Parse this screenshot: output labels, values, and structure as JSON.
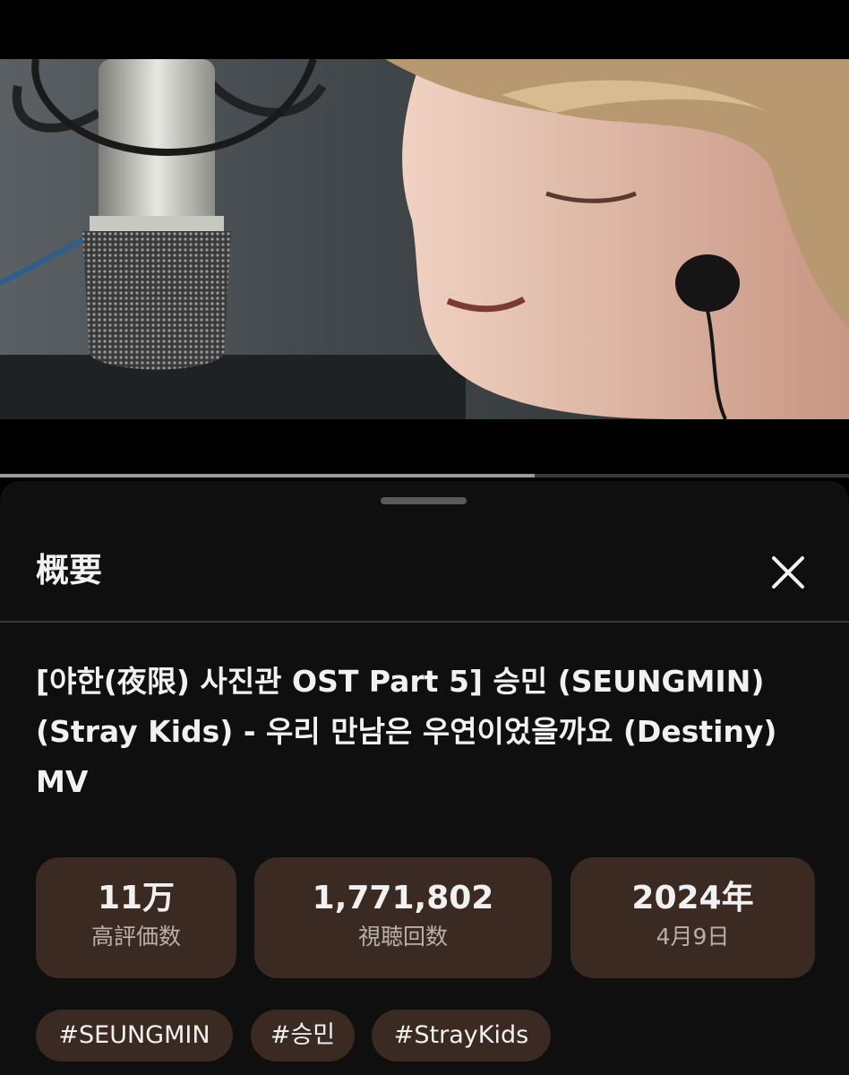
{
  "player": {
    "progress_fraction": 0.63
  },
  "sheet": {
    "title": "概要",
    "close_icon": "close-icon",
    "video_title": "[야한(夜限) 사진관 OST Part 5] 승민 (SEUNGMIN) (Stray Kids) - 우리 만남은 우연이었을까요 (Destiny) MV"
  },
  "stats": [
    {
      "value": "11万",
      "label": "高評価数"
    },
    {
      "value": "1,771,802",
      "label": "視聴回数"
    },
    {
      "value": "2024年",
      "label": "4月9日"
    }
  ],
  "tags": [
    "#SEUNGMIN",
    "#승민",
    "#StrayKids"
  ],
  "colors": {
    "sheet_bg": "#0f0f0f",
    "chip_bg": "#3a2a22",
    "text_primary": "#f1f1f1",
    "text_secondary": "#b8b0aa"
  }
}
